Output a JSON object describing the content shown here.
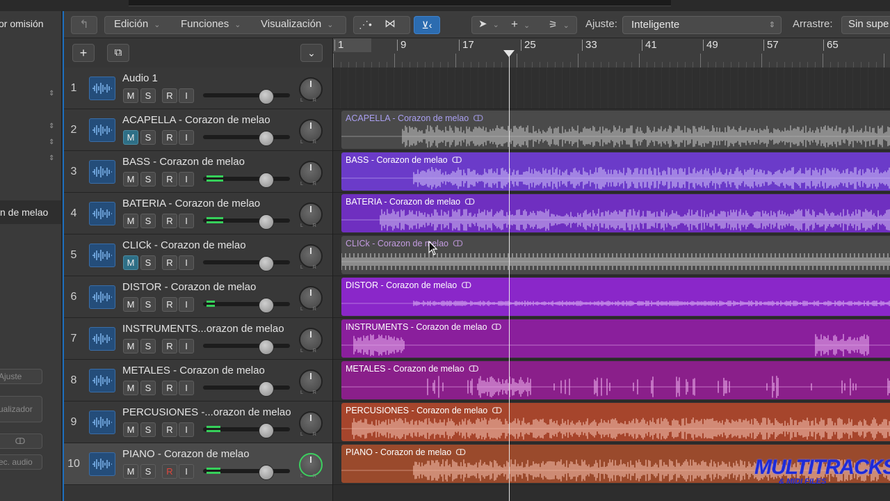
{
  "inspector": {
    "title": "or omisión",
    "region_name": "n de melao",
    "ajuste_btn": "Ajuste",
    "visualizador_btn": "ualizador",
    "loop_btn": "ↀ",
    "rec_audio_btn": "ec. audio"
  },
  "toolbar": {
    "back_icon": "↰",
    "menus": [
      "Edición",
      "Funciones",
      "Visualización"
    ],
    "ajuste_label": "Ajuste:",
    "ajuste_value": "Inteligente",
    "arrastre_label": "Arrastre:",
    "arrastre_value": "Sin supe"
  },
  "track_header": {
    "add_button": "+",
    "dup_button": "⧉",
    "collapse_button": "⌄"
  },
  "ruler": {
    "bars": [
      "1",
      "9",
      "17",
      "25",
      "33",
      "41",
      "49",
      "57",
      "65"
    ]
  },
  "tracks": [
    {
      "num": "1",
      "name": "Audio 1",
      "m": "M",
      "s": "S",
      "r": "R",
      "i": "I",
      "mute": false,
      "meter": 0
    },
    {
      "num": "2",
      "name": "ACAPELLA - Corazon de melao",
      "m": "M",
      "s": "S",
      "r": "R",
      "i": "I",
      "mute": true,
      "meter": 0
    },
    {
      "num": "3",
      "name": "BASS - Corazon de melao",
      "m": "M",
      "s": "S",
      "r": "R",
      "i": "I",
      "mute": false,
      "meter": 0.3
    },
    {
      "num": "4",
      "name": "BATERIA - Corazon de melao",
      "m": "M",
      "s": "S",
      "r": "R",
      "i": "I",
      "mute": false,
      "meter": 0.3
    },
    {
      "num": "5",
      "name": "CLICk - Corazon de melao",
      "m": "M",
      "s": "S",
      "r": "R",
      "i": "I",
      "mute": true,
      "meter": 0
    },
    {
      "num": "6",
      "name": "DISTOR - Corazon de melao",
      "m": "M",
      "s": "S",
      "r": "R",
      "i": "I",
      "mute": false,
      "meter": 0.15
    },
    {
      "num": "7",
      "name": "INSTRUMENTS...orazon de melao",
      "m": "M",
      "s": "S",
      "r": "R",
      "i": "I",
      "mute": false,
      "meter": 0
    },
    {
      "num": "8",
      "name": "METALES - Corazon de melao",
      "m": "M",
      "s": "S",
      "r": "R",
      "i": "I",
      "mute": false,
      "meter": 0
    },
    {
      "num": "9",
      "name": "PERCUSIONES -...orazon de melao",
      "m": "M",
      "s": "S",
      "r": "R",
      "i": "I",
      "mute": false,
      "meter": 0.25
    },
    {
      "num": "10",
      "name": "PIANO - Corazon de melao",
      "m": "M",
      "s": "S",
      "r": "R",
      "i": "I",
      "mute": false,
      "meter": 0.25
    }
  ],
  "regions": [
    {
      "label": "ACAPELLA - Corazon de melao",
      "color": "#4a4a4a",
      "text": "#a99ff0",
      "wave": "#b9b9b9",
      "start": 0.11
    },
    {
      "label": "BASS - Corazon de melao",
      "color": "#6b3bc9",
      "text": "#ffffff",
      "wave": "#c7b4f5",
      "start": 0.13
    },
    {
      "label": "BATERIA - Corazon de melao",
      "color": "#6f2fc0",
      "text": "#ffffff",
      "wave": "#c9b0f0",
      "start": 0.07
    },
    {
      "label": "CLICk - Corazon de melao",
      "color": "#4a4a4a",
      "text": "#c39be0",
      "wave": "#b8b8b8",
      "start": 0.0
    },
    {
      "label": "DISTOR - Corazon de melao",
      "color": "#8a27c9",
      "text": "#ffffff",
      "wave": "#d4a8f0",
      "start": 0.13
    },
    {
      "label": "INSTRUMENTS - Corazon de melao",
      "color": "#8a1f9c",
      "text": "#ffffff",
      "wave": "#e3a6ea",
      "start": 0.02
    },
    {
      "label": "METALES - Corazon de melao",
      "color": "#8a1f8a",
      "text": "#ffffff",
      "wave": "#e6a6e6",
      "start": 0.13
    },
    {
      "label": "PERCUSIONES - Corazon de melao",
      "color": "#a6452c",
      "text": "#ffffff",
      "wave": "#f0b9a8",
      "start": 0.02
    },
    {
      "label": "PIANO - Corazon de melao",
      "color": "#9a4a2c",
      "text": "#ffffff",
      "wave": "#f0b7a4",
      "start": 0.13
    }
  ],
  "logo": {
    "main": "MULTITRACKS",
    "sub": "& MIDI FILES"
  }
}
